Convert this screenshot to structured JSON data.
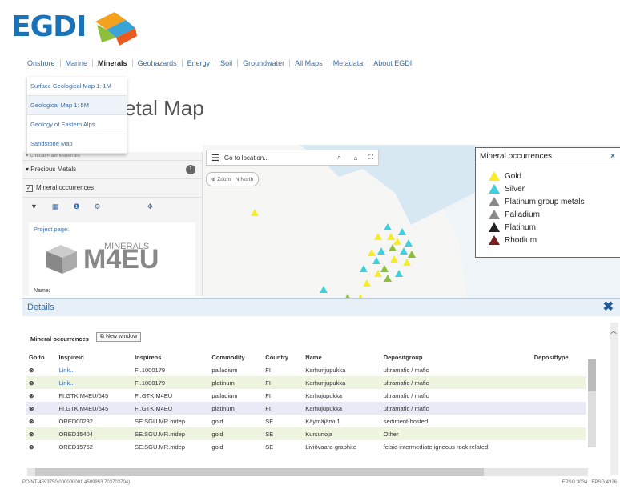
{
  "logo": {
    "text": "EGDI"
  },
  "nav": {
    "items": [
      "Onshore",
      "Marine",
      "Minerals",
      "Geohazards",
      "Energy",
      "Soil",
      "Groundwater",
      "All Maps",
      "Metadata",
      "About EGDI"
    ],
    "active_index": 2
  },
  "dropdown": {
    "items": [
      "Surface Geological Map 1: 1M",
      "Geological Map 1: 5M",
      "Geology of Eastern Alps",
      "Sandstone Map"
    ]
  },
  "page_title": "etal Map",
  "sidebar": {
    "critical": "Critical Raw Materials",
    "precious": "Precious Metals",
    "precious_count": "1",
    "mineral_occ": "Mineral occurrences",
    "project_label": "Project page:",
    "logo_text": "MINERALS",
    "logo_big": "M4EU",
    "name_label": "Name:"
  },
  "map": {
    "goto_placeholder": "Go to location...",
    "zoom_label": "Zoom",
    "north_label": "North"
  },
  "legend": {
    "title": "Mineral occurrences",
    "close": "×",
    "items": [
      {
        "label": "Gold",
        "color": "#f7ec2a"
      },
      {
        "label": "Silver",
        "color": "#3fd0e0"
      },
      {
        "label": "Platinum group metals",
        "color": "#ffffff"
      },
      {
        "label": "Palladium",
        "color": "#8a8a8a"
      },
      {
        "label": "Platinum",
        "color": "#222222"
      },
      {
        "label": "Rhodium",
        "color": "#7a1f1f"
      }
    ]
  },
  "details": {
    "title": "Details",
    "close": "✖",
    "section_label": "Mineral occurrences",
    "new_window": "New window",
    "columns": [
      "Go to",
      "Inspireid",
      "Inspirens",
      "Commodity",
      "Country",
      "Name",
      "Depositgroup",
      "Deposittype"
    ],
    "rows": [
      {
        "inspireid": "Link...",
        "inspirens": "FI.1000179",
        "commodity": "palladium",
        "country": "FI",
        "name": "Karhunjupukka",
        "depositgroup": "ultramafic / mafic",
        "deposittype": ""
      },
      {
        "inspireid": "Link...",
        "inspirens": "FI.1000179",
        "commodity": "platinum",
        "country": "FI",
        "name": "Karhunjupukka",
        "depositgroup": "ultramafic / mafic",
        "deposittype": ""
      },
      {
        "inspireid": "FI.GTK.M4EU/645",
        "inspirens": "FI.GTK.M4EU",
        "commodity": "palladium",
        "country": "FI",
        "name": "Karhujupukka",
        "depositgroup": "ultramafic / mafic",
        "deposittype": ""
      },
      {
        "inspireid": "FI.GTK.M4EU/645",
        "inspirens": "FI.GTK.M4EU",
        "commodity": "platinum",
        "country": "FI",
        "name": "Karhujupukka",
        "depositgroup": "ultramafic / mafic",
        "deposittype": ""
      },
      {
        "inspireid": "ORED00282",
        "inspirens": "SE.SGU.MR.mdep",
        "commodity": "gold",
        "country": "SE",
        "name": "Käymäjärvi 1",
        "depositgroup": "sediment-hosted",
        "deposittype": ""
      },
      {
        "inspireid": "ORED15404",
        "inspirens": "SE.SGU.MR.mdep",
        "commodity": "gold",
        "country": "SE",
        "name": "Kursunoja",
        "depositgroup": "Other",
        "deposittype": ""
      },
      {
        "inspireid": "ORED15752",
        "inspirens": "SE.SGU.MR.mdep",
        "commodity": "gold",
        "country": "SE",
        "name": "Liviövaara-graphite",
        "depositgroup": "felsic-intermediate igneous rock related",
        "deposittype": ""
      }
    ]
  },
  "status": {
    "coords": "POINT(4593750.000000001 4509953.703703704)",
    "crs1": "EPSG:3034",
    "crs2": "EPSG:4326"
  }
}
